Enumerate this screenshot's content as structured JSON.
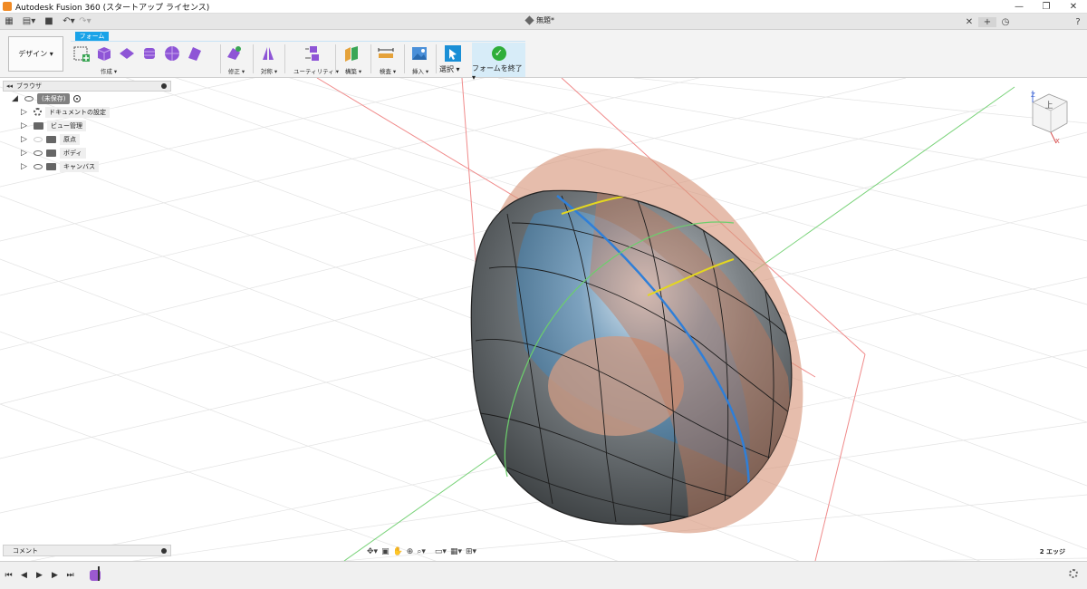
{
  "window": {
    "title": "Autodesk Fusion 360 (スタートアップ ライセンス)"
  },
  "document": {
    "tab_name": "無題*"
  },
  "workspace": {
    "label": "デザイン ▾"
  },
  "ribbon": {
    "active_tab": "フォーム",
    "groups": {
      "create": "作成 ▾",
      "modify": "修正 ▾",
      "symmetry": "対称 ▾",
      "utility": "ユーティリティ ▾",
      "construct": "構築 ▾",
      "inspect": "検査 ▾",
      "insert": "挿入 ▾",
      "select": "選択 ▾",
      "finish": "フォームを終了 ▾"
    }
  },
  "browser": {
    "header": "ブラウザ",
    "root": "(未保存)",
    "items": [
      {
        "label": "ドキュメントの設定"
      },
      {
        "label": "ビュー管理"
      },
      {
        "label": "原点"
      },
      {
        "label": "ボディ"
      },
      {
        "label": "キャンバス"
      }
    ]
  },
  "comment": {
    "label": "コメント"
  },
  "status": {
    "selection": "2 エッジ"
  },
  "viewcube": {
    "face_label": "上",
    "axis_z": "Z",
    "axis_x": "X"
  },
  "colors": {
    "accent": "#1aa3e8",
    "finish_bg": "#d7ecf8",
    "finish_check": "#2fae3a",
    "form_icon": "#8e55d6",
    "canvas_tint": "#d99a7f",
    "body": "#6a6e70",
    "selected_edge": "#2f7fd8",
    "highlight_edge": "#e4d71f"
  },
  "icons": {
    "apps": "grid-icon",
    "file": "file-icon",
    "save": "save-icon",
    "undo": "undo-icon",
    "redo": "redo-icon",
    "close": "close-icon",
    "new_tab": "plus-icon",
    "job_status": "clock-icon",
    "help": "help-icon"
  }
}
